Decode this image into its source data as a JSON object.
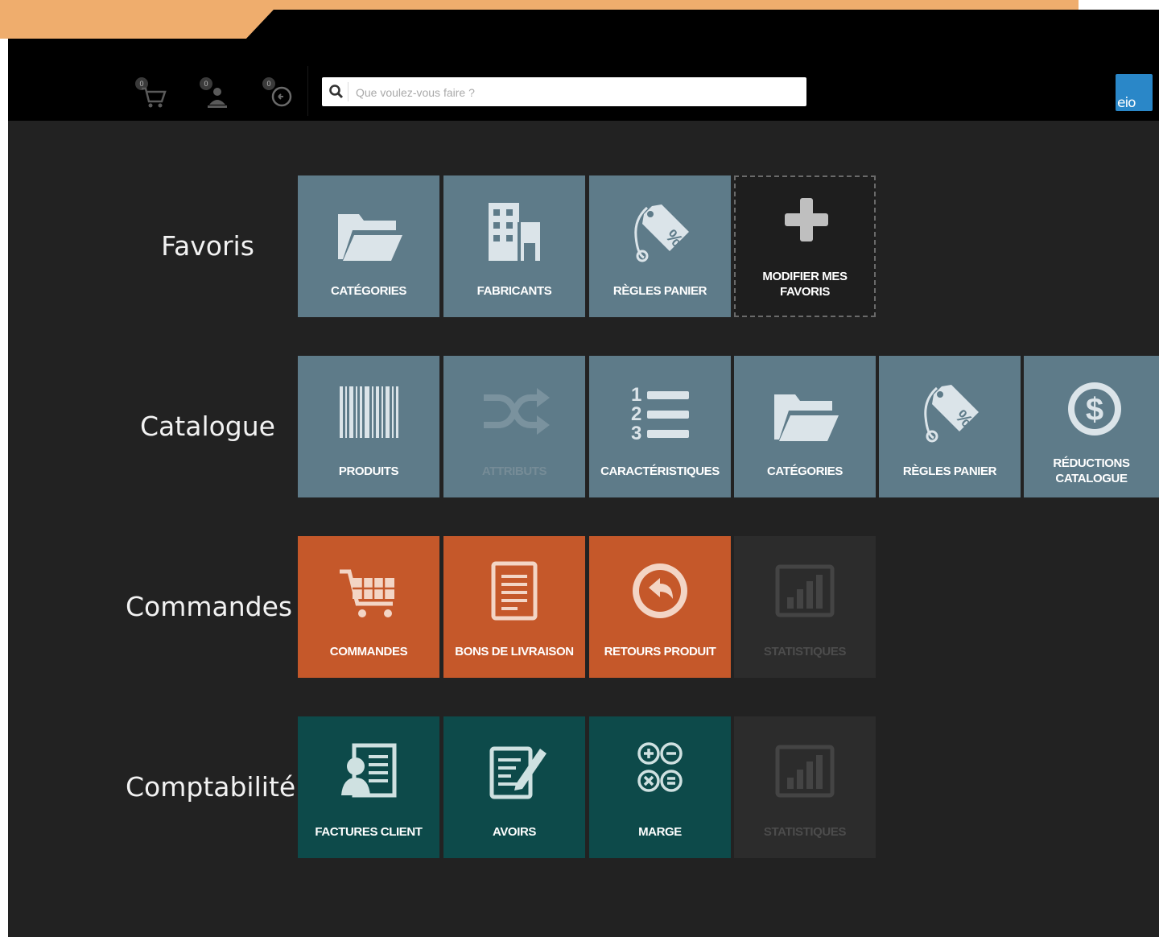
{
  "topbar": {
    "quick_actions": [
      {
        "name": "cart",
        "count": "0"
      },
      {
        "name": "customer",
        "count": "0"
      },
      {
        "name": "return",
        "count": "0"
      }
    ],
    "search": {
      "placeholder": "Que voulez-vous faire ?",
      "value": ""
    },
    "logo_text": "eio"
  },
  "colors": {
    "blue": "#5e7b89",
    "orange": "#c5582a",
    "teal": "#0d4a4a",
    "disabled": "#2c2c2c",
    "background": "#222222",
    "accent_band": "#efad6d"
  },
  "sections": [
    {
      "label": "Favoris",
      "tiles": [
        {
          "label": "CATÉGORIES",
          "icon": "folder-icon",
          "style": "blue"
        },
        {
          "label": "FABRICANTS",
          "icon": "building-icon",
          "style": "blue"
        },
        {
          "label": "RÈGLES PANIER",
          "icon": "price-tag-icon",
          "style": "blue"
        },
        {
          "label": "MODIFIER MES FAVORIS",
          "icon": "plus-icon",
          "style": "add"
        }
      ]
    },
    {
      "label": "Catalogue",
      "tiles": [
        {
          "label": "PRODUITS",
          "icon": "barcode-icon",
          "style": "blue"
        },
        {
          "label": "ATTRIBUTS",
          "icon": "shuffle-icon",
          "style": "blue",
          "disabled": true
        },
        {
          "label": "CARACTÉRISTIQUES",
          "icon": "numbered-list-icon",
          "style": "blue"
        },
        {
          "label": "CATÉGORIES",
          "icon": "folder-icon",
          "style": "blue"
        },
        {
          "label": "RÈGLES PANIER",
          "icon": "price-tag-icon",
          "style": "blue"
        },
        {
          "label": "RÉDUCTIONS CATALOGUE",
          "icon": "dollar-circle-icon",
          "style": "blue"
        }
      ]
    },
    {
      "label": "Commandes",
      "tiles": [
        {
          "label": "COMMANDES",
          "icon": "cart-icon",
          "style": "orange"
        },
        {
          "label": "BONS DE LIVRAISON",
          "icon": "document-icon",
          "style": "orange"
        },
        {
          "label": "RETOURS PRODUIT",
          "icon": "return-arrow-icon",
          "style": "orange"
        },
        {
          "label": "STATISTIQUES",
          "icon": "bar-chart-icon",
          "style": "dark"
        }
      ]
    },
    {
      "label": "Comptabilité",
      "tiles": [
        {
          "label": "FACTURES CLIENT",
          "icon": "invoice-icon",
          "style": "teal"
        },
        {
          "label": "AVOIRS",
          "icon": "credit-note-icon",
          "style": "teal"
        },
        {
          "label": "MARGE",
          "icon": "calculator-icon",
          "style": "teal"
        },
        {
          "label": "STATISTIQUES",
          "icon": "bar-chart-icon",
          "style": "dark"
        }
      ]
    }
  ]
}
